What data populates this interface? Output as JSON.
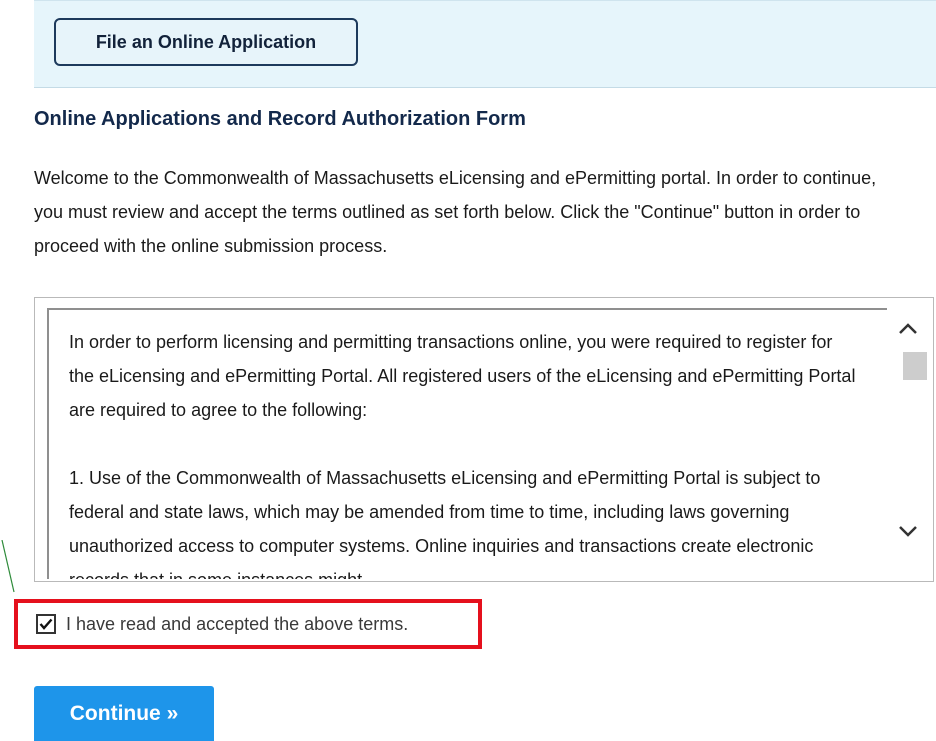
{
  "header": {
    "file_button_label": "File an Online Application"
  },
  "form": {
    "title": "Online Applications and Record Authorization Form",
    "intro": "Welcome to the Commonwealth of Massachusetts eLicensing and ePermitting portal. In order to continue, you must review and accept the terms outlined as set forth below. Click the \"Continue\" button in order to proceed with the online submission process.",
    "terms": [
      "In order to perform licensing and permitting transactions online, you were required to register for the eLicensing and ePermitting Portal. All registered users of the eLicensing and ePermitting Portal are required to agree to the following:",
      "1. Use of the Commonwealth of Massachusetts eLicensing and ePermitting Portal is subject to federal and state laws, which may be amended from time to time, including laws governing unauthorized access to computer systems. Online inquiries and transactions create electronic records that in some instances might"
    ],
    "accept_label": "I have read and accepted the above terms.",
    "accept_checked": true,
    "continue_label": "Continue »"
  },
  "icons": {
    "scroll_up": "chevron-up-icon",
    "scroll_down": "chevron-down-icon",
    "checkbox": "checkmark-icon"
  },
  "colors": {
    "accent": "#1e95ea",
    "highlight": "#e5101d",
    "title": "#13294b"
  }
}
